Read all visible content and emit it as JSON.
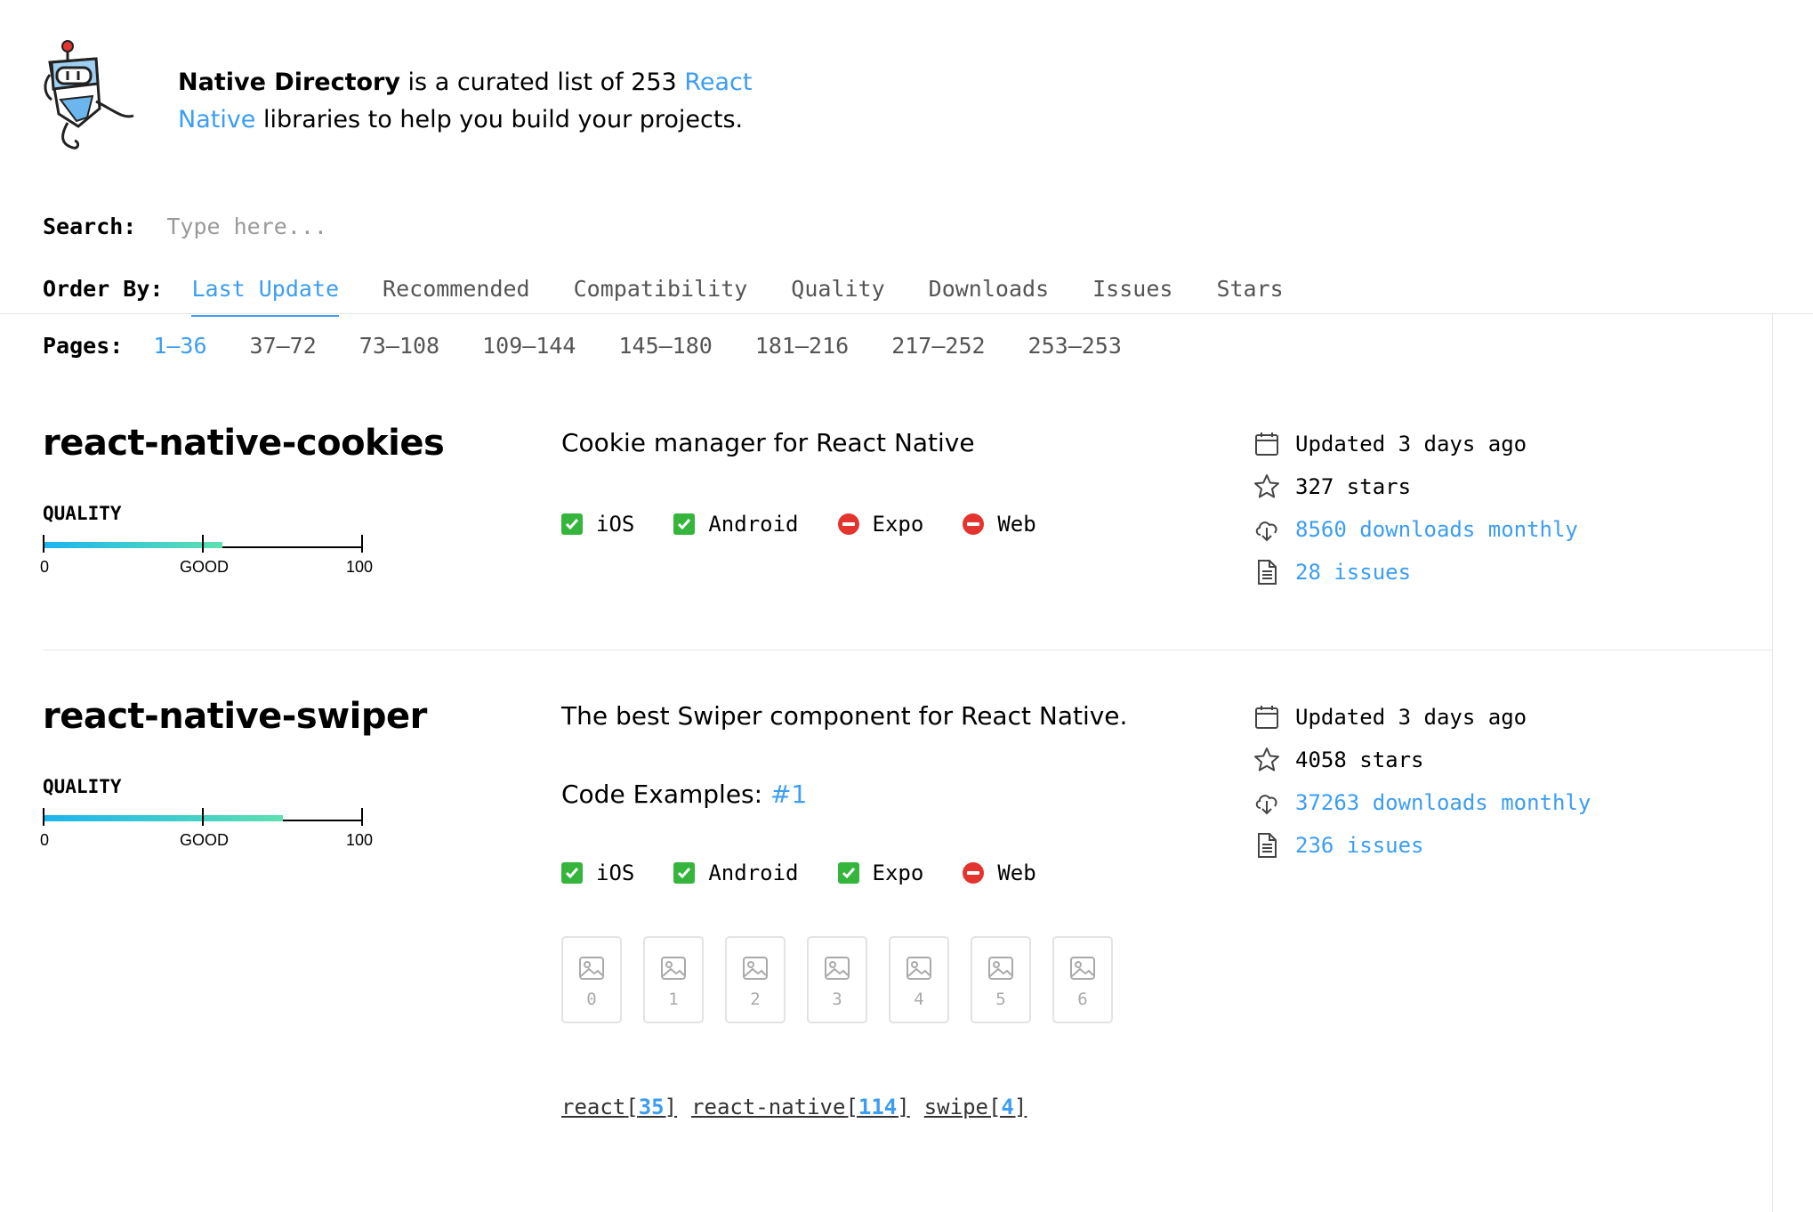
{
  "header": {
    "brand": "Native Directory",
    "text_before_link": " is a curated list of 253 ",
    "link_text": "React Native",
    "text_after_link": " libraries to help you build your projects."
  },
  "search": {
    "label": "Search:",
    "placeholder": "Type here..."
  },
  "order": {
    "label": "Order By:",
    "tabs": [
      "Last Update",
      "Recommended",
      "Compatibility",
      "Quality",
      "Downloads",
      "Issues",
      "Stars"
    ],
    "active": "Last Update"
  },
  "pages": {
    "label": "Pages:",
    "items": [
      "1–36",
      "37–72",
      "73–108",
      "109–144",
      "145–180",
      "181–216",
      "217–252",
      "253–253"
    ],
    "active": "1–36"
  },
  "quality_scale": {
    "label": "QUALITY",
    "min": "0",
    "mid": "GOOD",
    "max": "100"
  },
  "libraries": [
    {
      "name": "react-native-cookies",
      "description": "Cookie manager for React Native",
      "quality": 0.56,
      "platforms": [
        {
          "name": "iOS",
          "supported": true
        },
        {
          "name": "Android",
          "supported": true
        },
        {
          "name": "Expo",
          "supported": false
        },
        {
          "name": "Web",
          "supported": false
        }
      ],
      "updated": "Updated 3 days ago",
      "stars": "327 stars",
      "downloads": "8560 downloads monthly",
      "issues": "28 issues"
    },
    {
      "name": "react-native-swiper",
      "description": "The best Swiper component for React Native.",
      "code_examples_label": "Code Examples: ",
      "code_examples_link": "#1",
      "quality": 0.75,
      "platforms": [
        {
          "name": "iOS",
          "supported": true
        },
        {
          "name": "Android",
          "supported": true
        },
        {
          "name": "Expo",
          "supported": true
        },
        {
          "name": "Web",
          "supported": false
        }
      ],
      "updated": "Updated 3 days ago",
      "stars": "4058 stars",
      "downloads": "37263 downloads monthly",
      "issues": "236 issues",
      "images": [
        "0",
        "1",
        "2",
        "3",
        "4",
        "5",
        "6"
      ],
      "tags": [
        {
          "name": "react",
          "count": "35"
        },
        {
          "name": "react-native",
          "count": "114"
        },
        {
          "name": "swipe",
          "count": "4"
        }
      ]
    }
  ],
  "colors": {
    "link": "#3c9df2",
    "check": "#35b53c",
    "no": "#e3342f"
  }
}
